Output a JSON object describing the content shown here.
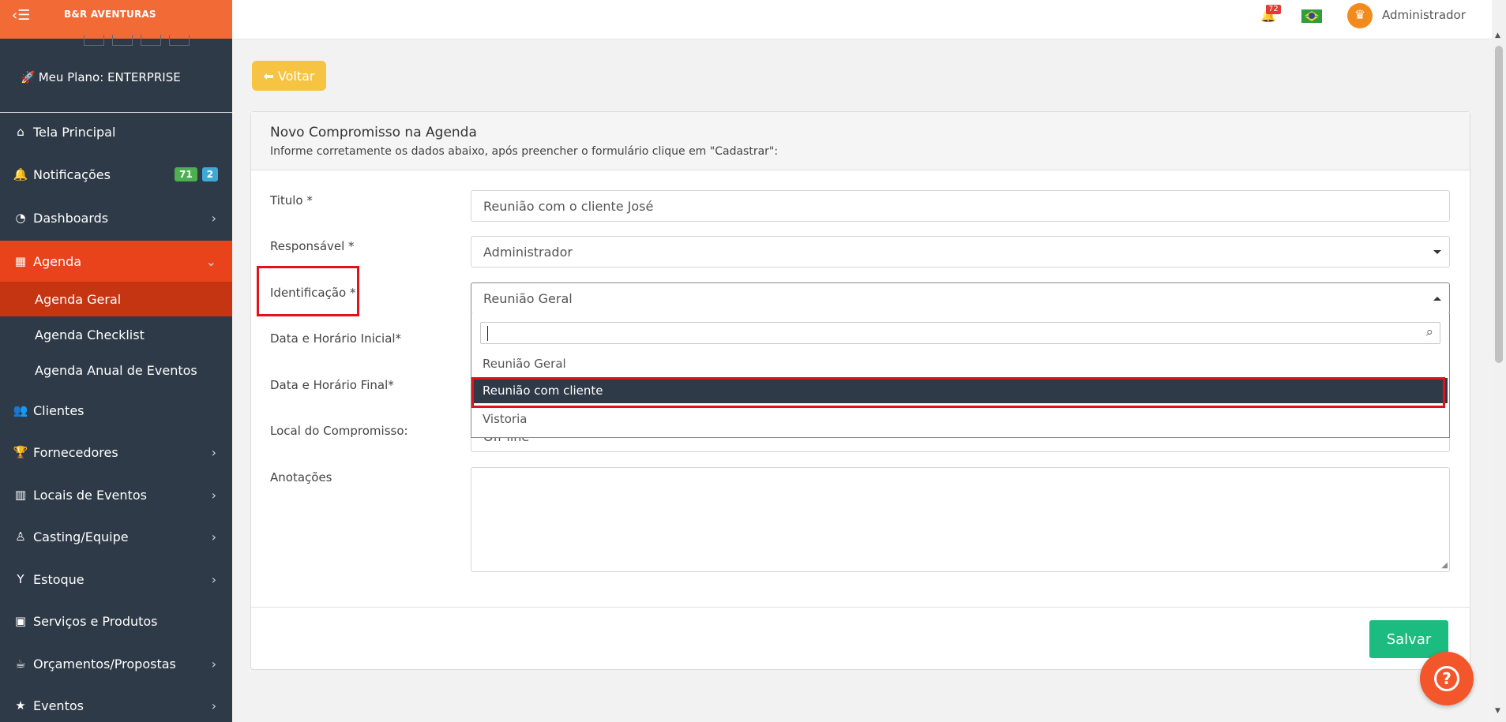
{
  "brand": {
    "name": "B&R AVENTURAS",
    "plan": "Meu Plano: ENTERPRISE"
  },
  "topbar": {
    "notification_count": "72",
    "user_name": "Administrador"
  },
  "sidebar": {
    "items": [
      {
        "label": "Tela Principal",
        "icon": "home-icon"
      },
      {
        "label": "Notificações",
        "icon": "bell-icon",
        "badge_green": "71",
        "badge_blue": "2"
      },
      {
        "label": "Dashboards",
        "icon": "dashboard-icon"
      },
      {
        "label": "Agenda",
        "icon": "calendar-icon"
      },
      {
        "label": "Clientes",
        "icon": "users-icon"
      },
      {
        "label": "Fornecedores",
        "icon": "trophy-icon"
      },
      {
        "label": "Locais de Eventos",
        "icon": "building-icon"
      },
      {
        "label": "Casting/Equipe",
        "icon": "person-icon"
      },
      {
        "label": "Estoque",
        "icon": "glass-icon"
      },
      {
        "label": "Serviços e Produtos",
        "icon": "box-icon"
      },
      {
        "label": "Orçamentos/Propostas",
        "icon": "cup-icon"
      },
      {
        "label": "Eventos",
        "icon": "star-icon"
      }
    ],
    "agenda_sub": [
      "Agenda Geral",
      "Agenda Checklist",
      "Agenda Anual de Eventos"
    ]
  },
  "back_label": "Voltar",
  "form": {
    "title": "Novo Compromisso na Agenda",
    "subtitle": "Informe corretamente os dados abaixo, após preencher o formulário clique em \"Cadastrar\":",
    "titulo_label": "Titulo *",
    "titulo_value": "Reunião com o cliente José",
    "responsavel_label": "Responsável *",
    "responsavel_value": "Administrador",
    "identificacao_label": "Identificação *",
    "identificacao_value": "Reunião Geral",
    "data_inicial_label": "Data e Horário Inicial*",
    "data_final_label": "Data e Horário Final*",
    "local_label": "Local do Compromisso:",
    "local_value": "Off-line",
    "anotacoes_label": "Anotações",
    "save_label": "Salvar"
  },
  "dropdown": {
    "options": [
      "Reunião Geral",
      "Reunião com cliente",
      "Vistoria"
    ],
    "selected_index": 1
  },
  "colors": {
    "sidebar": "#2e3a47",
    "accent": "#f26a36",
    "active_menu": "#e8431a",
    "active_sub": "#c63512",
    "save": "#1cbb7f",
    "back": "#f6c343",
    "highlight": "#e0121b"
  }
}
